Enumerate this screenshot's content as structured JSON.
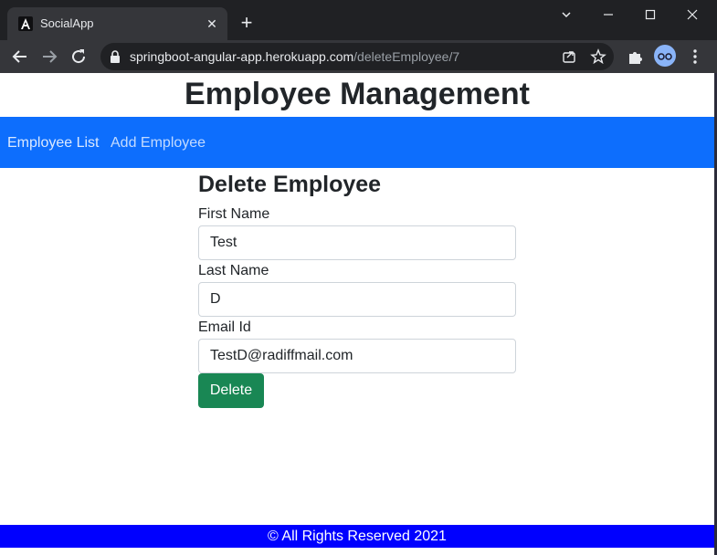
{
  "browser": {
    "tab_title": "SocialApp",
    "new_tab_symbol": "+",
    "url_host": "springboot-angular-app.herokuapp.com",
    "url_path": "/deleteEmployee/7"
  },
  "app": {
    "title": "Employee Management"
  },
  "nav": {
    "items": [
      {
        "label": "Employee List"
      },
      {
        "label": "Add Employee"
      }
    ]
  },
  "form": {
    "heading": "Delete Employee",
    "first_name": {
      "label": "First Name",
      "value": "Test"
    },
    "last_name": {
      "label": "Last Name",
      "value": "D"
    },
    "email": {
      "label": "Email Id",
      "value": "TestD@radiffmail.com"
    },
    "submit_label": "Delete"
  },
  "footer": {
    "text": "© All Rights Reserved 2021"
  },
  "colors": {
    "navbar": "#0d6efd",
    "delete_button": "#198754",
    "footer": "#0000ff"
  }
}
